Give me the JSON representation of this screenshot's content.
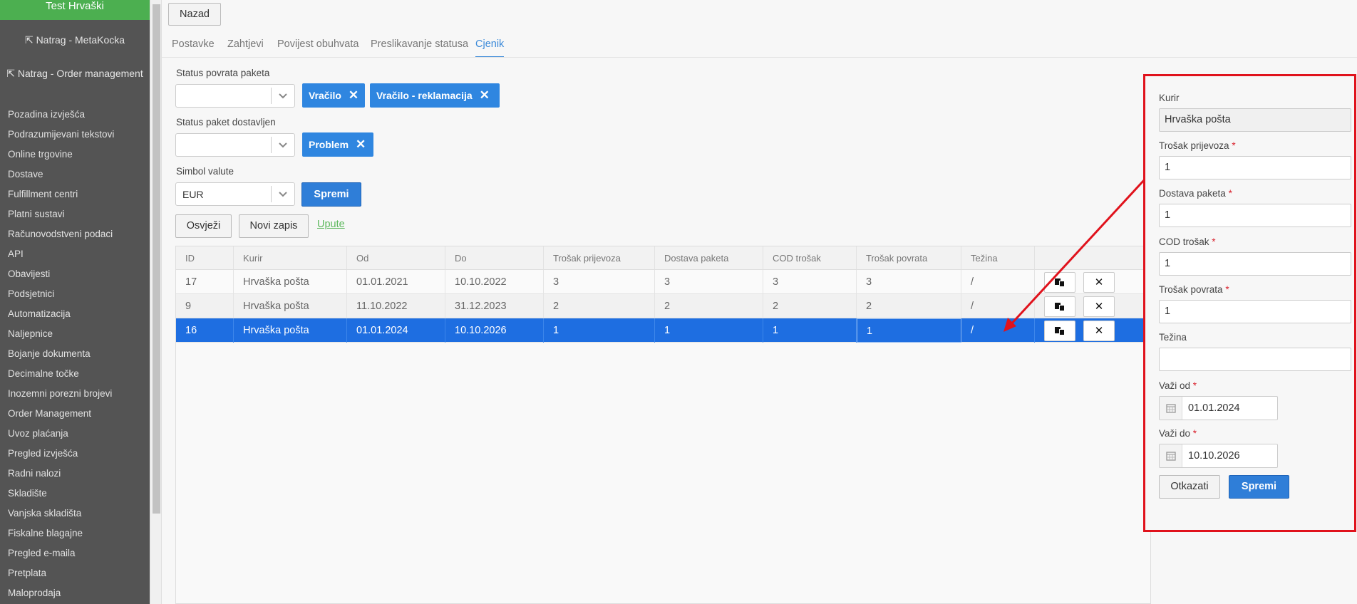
{
  "sidebar": {
    "title": "Test Hrvaški",
    "links": [
      "Natrag - MetaKocka",
      "Natrag - Order management"
    ],
    "items": [
      "Pozadina izvješća",
      "Podrazumijevani tekstovi",
      "Online trgovine",
      "Dostave",
      "Fulfillment centri",
      "Platni sustavi",
      "Računovodstveni podaci",
      "API",
      "Obavijesti",
      "Podsjetnici",
      "Automatizacija",
      "Naljepnice",
      "Bojanje dokumenta",
      "Decimalne točke",
      "Inozemni porezni brojevi",
      "Order Management",
      "Uvoz plaćanja",
      "Pregled izvješća",
      "Radni nalozi",
      "Skladište",
      "Vanjska skladišta",
      "Fiskalne blagajne",
      "Pregled e-maila",
      "Pretplata",
      "Maloprodaja"
    ]
  },
  "toolbar": {
    "back_label": "Nazad"
  },
  "tabs": [
    {
      "label": "Postavke",
      "active": false
    },
    {
      "label": "Zahtjevi",
      "active": false
    },
    {
      "label": "Povijest obuhvata",
      "active": false
    },
    {
      "label": "Preslikavanje statusa",
      "active": false
    },
    {
      "label": "Cjenik",
      "active": true
    }
  ],
  "form": {
    "return_status": {
      "label": "Status povrata paketa",
      "value": "",
      "tags": [
        "Vračilo",
        "Vračilo - reklamacija"
      ]
    },
    "delivered_status": {
      "label": "Status paket dostavljen",
      "value": "",
      "tags": [
        "Problem"
      ]
    },
    "currency": {
      "label": "Simbol valute",
      "value": "EUR",
      "save_label": "Spremi"
    },
    "tag_remove_glyph": "✕"
  },
  "actions": {
    "refresh_label": "Osvježi",
    "new_label": "Novi zapis",
    "guide_label": "Upute"
  },
  "table": {
    "columns": [
      "ID",
      "Kurir",
      "Od",
      "Do",
      "Trošak prijevoza",
      "Dostava paketa",
      "COD trošak",
      "Trošak povrata",
      "Težina"
    ],
    "rows": [
      {
        "cells": [
          "17",
          "Hrvaška pošta",
          "01.01.2021",
          "10.10.2022",
          "3",
          "3",
          "3",
          "3",
          "/"
        ],
        "selected": false
      },
      {
        "cells": [
          "9",
          "Hrvaška pošta",
          "11.10.2022",
          "31.12.2023",
          "2",
          "2",
          "2",
          "2",
          "/"
        ],
        "selected": false
      },
      {
        "cells": [
          "16",
          "Hrvaška pošta",
          "01.01.2024",
          "10.10.2026",
          "1",
          "1",
          "1",
          "1",
          "/"
        ],
        "selected": true
      }
    ],
    "delete_glyph": "✕"
  },
  "edit_panel": {
    "courier": {
      "label": "Kurir",
      "value": "Hrvaška pošta"
    },
    "transport_cost": {
      "label": "Trošak prijevoza",
      "value": "1"
    },
    "package_delivery": {
      "label": "Dostava paketa",
      "value": "1"
    },
    "cod_cost": {
      "label": "COD trošak",
      "value": "1"
    },
    "return_cost": {
      "label": "Trošak povrata",
      "value": "1"
    },
    "weight": {
      "label": "Težina",
      "value": ""
    },
    "valid_from": {
      "label": "Važi od",
      "value": "01.01.2024"
    },
    "valid_to": {
      "label": "Važi do",
      "value": "10.10.2026"
    },
    "required_mark": "*",
    "cancel_label": "Otkazati",
    "save_label": "Spremi"
  },
  "colors": {
    "accent": "#2f7ed8",
    "sidebar_bg": "#545454",
    "sidebar_title_bg": "#4caf50",
    "selected_row": "#1e6ee1",
    "annotation": "#e0121c"
  }
}
